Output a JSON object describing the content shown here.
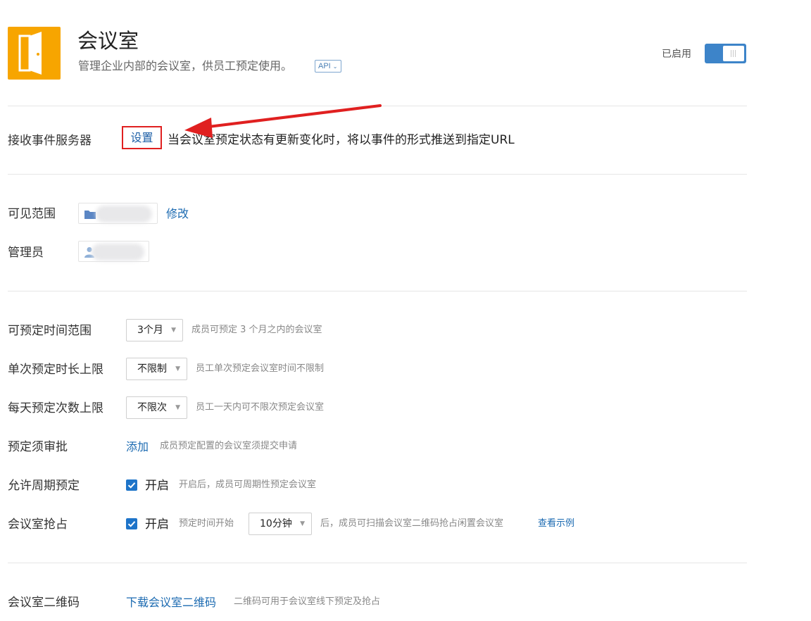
{
  "header": {
    "title": "会议室",
    "description": "管理企业内部的会议室，供员工预定使用。",
    "api_badge": "API",
    "status_label": "已启用",
    "enabled": true
  },
  "event_server": {
    "label": "接收事件服务器",
    "set_button": "设置",
    "description": "当会议室预定状态有更新变化时，将以事件的形式推送到指定URL"
  },
  "visibility": {
    "label": "可见范围",
    "edit_link": "修改"
  },
  "admin": {
    "label": "管理员"
  },
  "settings": {
    "booking_range": {
      "label": "可预定时间范围",
      "value": "3个月",
      "hint": "成员可预定 3 个月之内的会议室"
    },
    "duration_limit": {
      "label": "单次预定时长上限",
      "value": "不限制",
      "hint": "员工单次预定会议室时间不限制"
    },
    "daily_limit": {
      "label": "每天预定次数上限",
      "value": "不限次",
      "hint": "员工一天内可不限次预定会议室"
    },
    "approval": {
      "label": "预定须审批",
      "action": "添加",
      "hint": "成员预定配置的会议室须提交申请"
    },
    "recurring": {
      "label": "允许周期预定",
      "checked": true,
      "check_label": "开启",
      "hint": "开启后，成员可周期性预定会议室"
    },
    "grab": {
      "label": "会议室抢占",
      "checked": true,
      "check_label": "开启",
      "hint_before": "预定时间开始",
      "value": "10分钟",
      "hint_after": "后，成员可扫描会议室二维码抢占闲置会议室",
      "example_link": "查看示例"
    }
  },
  "qrcode": {
    "label": "会议室二维码",
    "download_link": "下载会议室二维码",
    "hint": "二维码可用于会议室线下预定及抢占"
  },
  "colors": {
    "accent": "#1b6ab1",
    "toggle": "#3d84c9",
    "app_icon": "#f7a500",
    "annotation": "#e02020"
  }
}
